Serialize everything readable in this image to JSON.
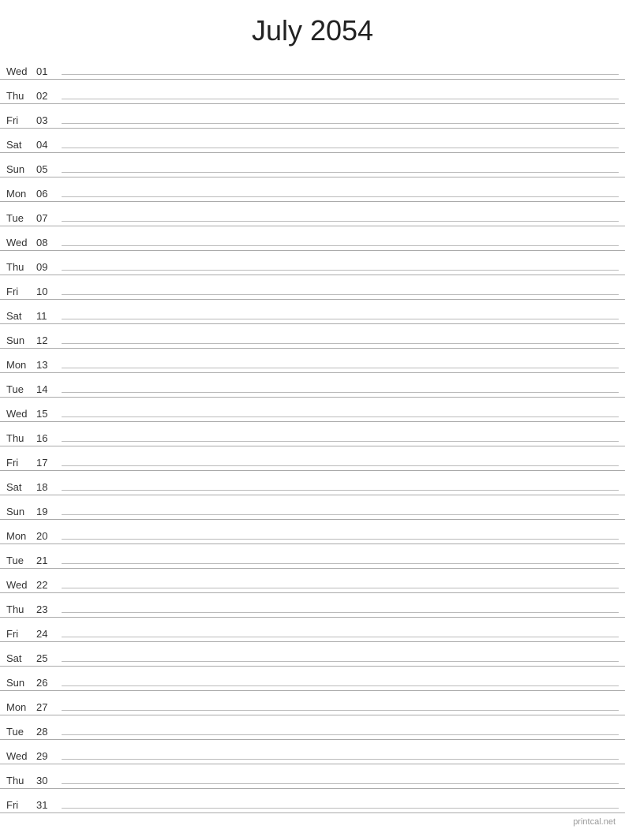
{
  "header": {
    "title": "July 2054"
  },
  "days": [
    {
      "name": "Wed",
      "num": "01"
    },
    {
      "name": "Thu",
      "num": "02"
    },
    {
      "name": "Fri",
      "num": "03"
    },
    {
      "name": "Sat",
      "num": "04"
    },
    {
      "name": "Sun",
      "num": "05"
    },
    {
      "name": "Mon",
      "num": "06"
    },
    {
      "name": "Tue",
      "num": "07"
    },
    {
      "name": "Wed",
      "num": "08"
    },
    {
      "name": "Thu",
      "num": "09"
    },
    {
      "name": "Fri",
      "num": "10"
    },
    {
      "name": "Sat",
      "num": "11"
    },
    {
      "name": "Sun",
      "num": "12"
    },
    {
      "name": "Mon",
      "num": "13"
    },
    {
      "name": "Tue",
      "num": "14"
    },
    {
      "name": "Wed",
      "num": "15"
    },
    {
      "name": "Thu",
      "num": "16"
    },
    {
      "name": "Fri",
      "num": "17"
    },
    {
      "name": "Sat",
      "num": "18"
    },
    {
      "name": "Sun",
      "num": "19"
    },
    {
      "name": "Mon",
      "num": "20"
    },
    {
      "name": "Tue",
      "num": "21"
    },
    {
      "name": "Wed",
      "num": "22"
    },
    {
      "name": "Thu",
      "num": "23"
    },
    {
      "name": "Fri",
      "num": "24"
    },
    {
      "name": "Sat",
      "num": "25"
    },
    {
      "name": "Sun",
      "num": "26"
    },
    {
      "name": "Mon",
      "num": "27"
    },
    {
      "name": "Tue",
      "num": "28"
    },
    {
      "name": "Wed",
      "num": "29"
    },
    {
      "name": "Thu",
      "num": "30"
    },
    {
      "name": "Fri",
      "num": "31"
    }
  ],
  "watermark": "printcal.net"
}
